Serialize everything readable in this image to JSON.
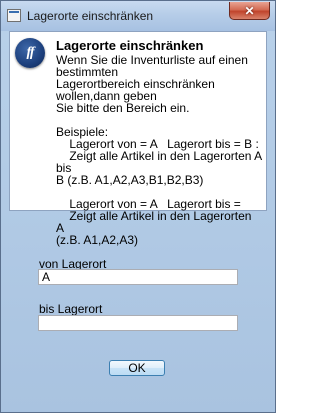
{
  "window": {
    "title": "Lagerorte einschränken",
    "close_label": "✕"
  },
  "panel": {
    "logo_text": "ff",
    "heading": "Lagerorte einschränken",
    "body": "Wenn Sie die Inventurliste auf einen bestimmten\nLagerortbereich einschränken wollen,dann geben\nSie bitte den Bereich ein.\n\nBeispiele:\n    Lagerort von = A   Lagerort bis = B :\n    Zeigt alle Artikel in den Lagerorten A bis\nB (z.B. A1,A2,A3,B1,B2,B3)\n\n    Lagerort von = A   Lagerort bis =\n    Zeigt alle Artikel in den Lagerorten A\n(z.B. A1,A2,A3)"
  },
  "form": {
    "von_label": "von Lagerort",
    "von_value": "A",
    "bis_label": "bis Lagerort",
    "bis_value": ""
  },
  "buttons": {
    "ok_label": "OK"
  }
}
